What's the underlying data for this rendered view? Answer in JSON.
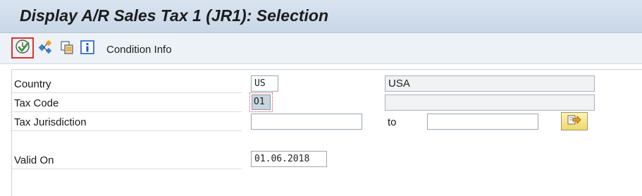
{
  "window": {
    "title": "Display A/R Sales Tax 1 (JR1): Selection"
  },
  "toolbar": {
    "buttons": [
      {
        "name": "execute",
        "icon": "execute-clock-check-icon"
      },
      {
        "name": "technical-info",
        "icon": "hierarchy-icon"
      },
      {
        "name": "copy",
        "icon": "copy-pages-icon"
      },
      {
        "name": "info",
        "icon": "info-icon"
      }
    ],
    "condition_info_label": "Condition Info"
  },
  "form": {
    "country": {
      "label": "Country",
      "value": "US",
      "description": "USA"
    },
    "tax_code": {
      "label": "Tax Code",
      "value": "O1",
      "description": ""
    },
    "tax_jurisdiction": {
      "label": "Tax Jurisdiction",
      "from": "",
      "to_label": "to",
      "to": ""
    },
    "valid_on": {
      "label": "Valid On",
      "value": "01.06.2018"
    }
  },
  "colors": {
    "title_bg": "#d9e4f0",
    "toolbar_bg": "#edf2f7",
    "highlight_border": "#e0312f",
    "multisel_bg": "#f1d86b"
  }
}
